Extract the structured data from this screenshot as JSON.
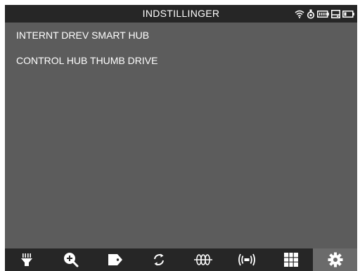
{
  "header": {
    "title": "INDSTILLINGER",
    "status_icons": [
      "wifi-icon",
      "hub-connection-icon",
      "battery-pack-icon",
      "storage-icon",
      "battery-icon"
    ]
  },
  "list": {
    "items": [
      {
        "label": "INTERNT DREV SMART HUB"
      },
      {
        "label": "CONTROL HUB THUMB DRIVE"
      }
    ]
  },
  "toolbar": {
    "items": [
      {
        "icon": "plug-icon"
      },
      {
        "icon": "zoom-in-icon"
      },
      {
        "icon": "tag-icon"
      },
      {
        "icon": "refresh-icon"
      },
      {
        "icon": "coil-icon"
      },
      {
        "icon": "broadcast-icon"
      },
      {
        "icon": "grid-icon"
      },
      {
        "icon": "gear-icon",
        "active": true
      }
    ]
  },
  "colors": {
    "screen_bg": "#5c5c5c",
    "bar_bg": "#262626",
    "active_tab_bg": "#6b6b6b",
    "text": "#ffffff"
  }
}
